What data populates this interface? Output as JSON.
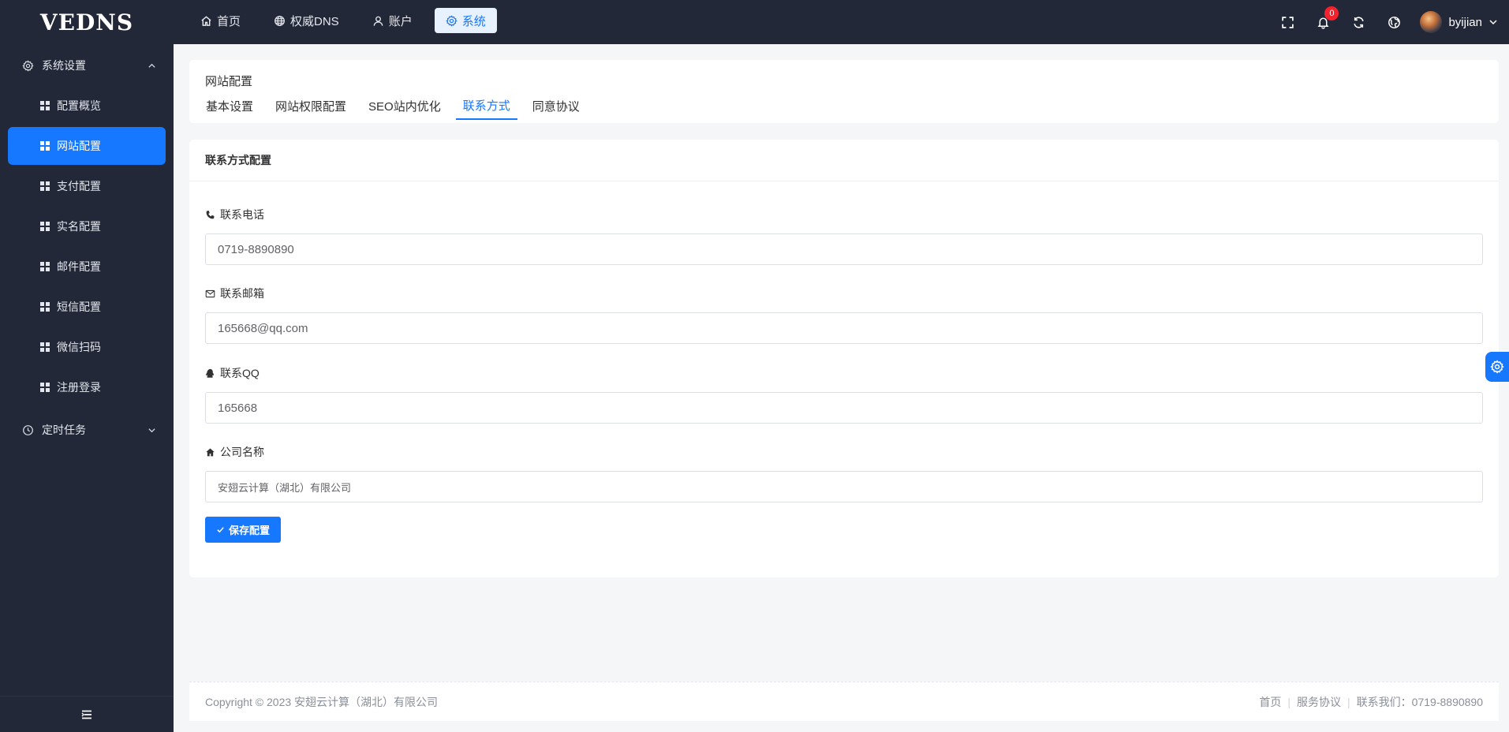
{
  "app": {
    "logo": "VEDNS"
  },
  "topnav": [
    {
      "label": "首页",
      "icon": "home-icon"
    },
    {
      "label": "权威DNS",
      "icon": "globe-icon"
    },
    {
      "label": "账户",
      "icon": "user-icon"
    },
    {
      "label": "系统",
      "icon": "gear-icon",
      "active": true
    }
  ],
  "header": {
    "notification_count": "0",
    "username": "byijian"
  },
  "sidebar": {
    "group_system": "系统设置",
    "items": [
      {
        "label": "配置概览"
      },
      {
        "label": "网站配置",
        "active": true
      },
      {
        "label": "支付配置"
      },
      {
        "label": "实名配置"
      },
      {
        "label": "邮件配置"
      },
      {
        "label": "短信配置"
      },
      {
        "label": "微信扫码"
      },
      {
        "label": "注册登录"
      }
    ],
    "group_tasks": "定时任务"
  },
  "page": {
    "title": "网站配置",
    "tabs": [
      {
        "label": "基本设置"
      },
      {
        "label": "网站权限配置"
      },
      {
        "label": "SEO站内优化"
      },
      {
        "label": "联系方式",
        "active": true
      },
      {
        "label": "同意协议"
      }
    ]
  },
  "form": {
    "title": "联系方式配置",
    "phone_label": "联系电话",
    "phone_value": "0719-8890890",
    "email_label": "联系邮箱",
    "email_value": "165668@qq.com",
    "qq_label": "联系QQ",
    "qq_value": "165668",
    "company_label": "公司名称",
    "company_value": "安翅云计算（湖北）有限公司",
    "save_label": "保存配置"
  },
  "footer": {
    "copyright": "Copyright © 2023 安翅云计算（湖北）有限公司",
    "link_home": "首页",
    "link_terms": "服务协议",
    "contact": "联系我们：0719-8890890"
  },
  "colors": {
    "accent": "#1677ff",
    "sidebar_bg": "#222838",
    "badge": "#f5222d"
  }
}
